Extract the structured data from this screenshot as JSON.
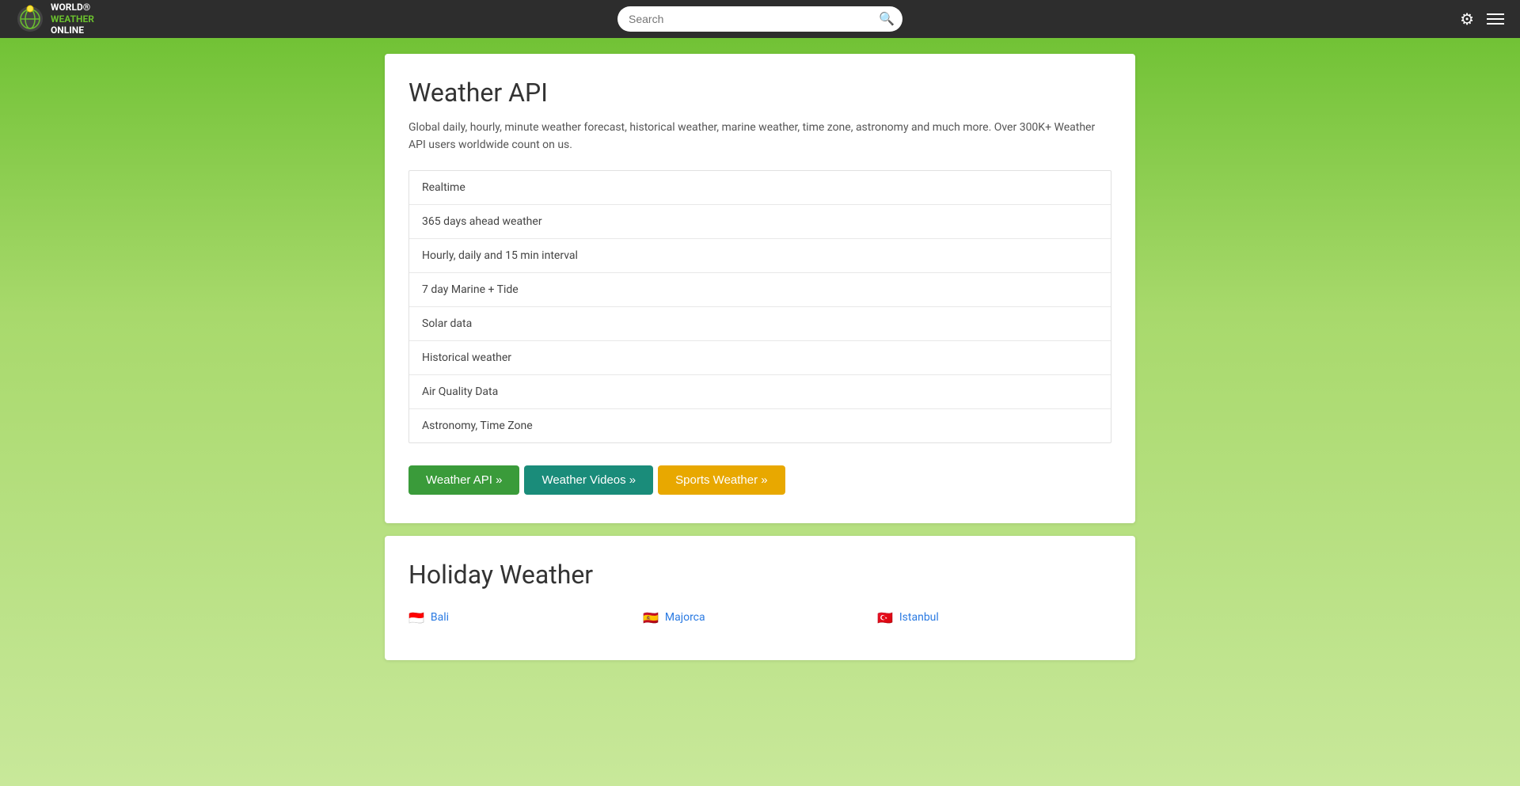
{
  "header": {
    "logo_line1": "WORLD®",
    "logo_line2": "WEATHER",
    "logo_line3": "ONLINE",
    "search_placeholder": "Search"
  },
  "weather_api_card": {
    "title": "Weather API",
    "description": "Global daily, hourly, minute weather forecast, historical weather, marine weather, time zone, astronomy and much more. Over 300K+ Weather API users worldwide count on us.",
    "features": [
      "Realtime",
      "365 days ahead weather",
      "Hourly, daily and 15 min interval",
      "7 day Marine + Tide",
      "Solar data",
      "Historical weather",
      "Air Quality Data",
      "Astronomy, Time Zone"
    ],
    "buttons": [
      {
        "label": "Weather API »",
        "style": "green"
      },
      {
        "label": "Weather Videos »",
        "style": "teal"
      },
      {
        "label": "Sports Weather »",
        "style": "yellow"
      }
    ]
  },
  "holiday_weather_card": {
    "title": "Holiday Weather",
    "destinations": [
      {
        "flag": "🇮🇩",
        "name": "Bali",
        "country": "id"
      },
      {
        "flag": "🇪🇸",
        "name": "Majorca",
        "country": "es"
      },
      {
        "flag": "🇹🇷",
        "name": "Istanbul",
        "country": "tr"
      }
    ]
  },
  "icons": {
    "search": "🔍",
    "settings": "⚙",
    "menu": "☰"
  }
}
